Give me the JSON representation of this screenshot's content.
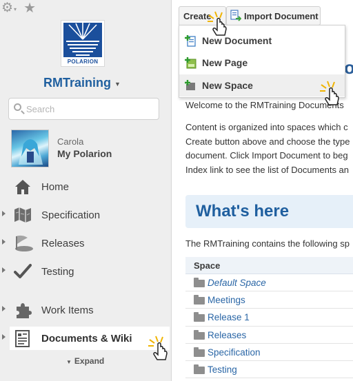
{
  "sidebar": {
    "project_name": "RMTraining",
    "logo_text": "POLARION",
    "search_placeholder": "Search",
    "user": {
      "name": "Carola",
      "link": "My Polarion"
    },
    "nav": [
      {
        "label": "Home",
        "icon": "home-icon"
      },
      {
        "label": "Specification",
        "icon": "map-icon"
      },
      {
        "label": "Releases",
        "icon": "flag-icon"
      },
      {
        "label": "Testing",
        "icon": "checkmark-icon"
      },
      {
        "label": "Work Items",
        "icon": "puzzle-icon"
      },
      {
        "label": "Documents & Wiki",
        "icon": "documents-icon",
        "active": true
      }
    ],
    "expand_label": "Expand"
  },
  "toolbar": {
    "create_label": "Create",
    "import_label": "Import Document"
  },
  "create_menu": {
    "items": [
      {
        "label": "New Document",
        "icon": "new-document-icon"
      },
      {
        "label": "New Page",
        "icon": "new-page-icon"
      },
      {
        "label": "New Space",
        "icon": "new-space-icon",
        "hover": true
      }
    ]
  },
  "main": {
    "title_peek": "oc",
    "intro": "Welcome to the RMTraining Documents",
    "paragraph": [
      "Content is organized into spaces which c",
      "Create button above and choose the type",
      "document. Click Import Document to beg",
      "Index link to see the list of Documents an"
    ],
    "section_title": "What's here",
    "description": "The RMTraining contains the following sp",
    "table": {
      "header": "Space",
      "rows": [
        "Default Space",
        "Meetings",
        "Release 1",
        "Releases",
        "Specification",
        "Testing"
      ]
    }
  },
  "colors": {
    "accent": "#1f5f9f",
    "sidebar_bg": "#eeeeee",
    "section_bg": "#e6f0f9",
    "link": "#2a66a6"
  }
}
